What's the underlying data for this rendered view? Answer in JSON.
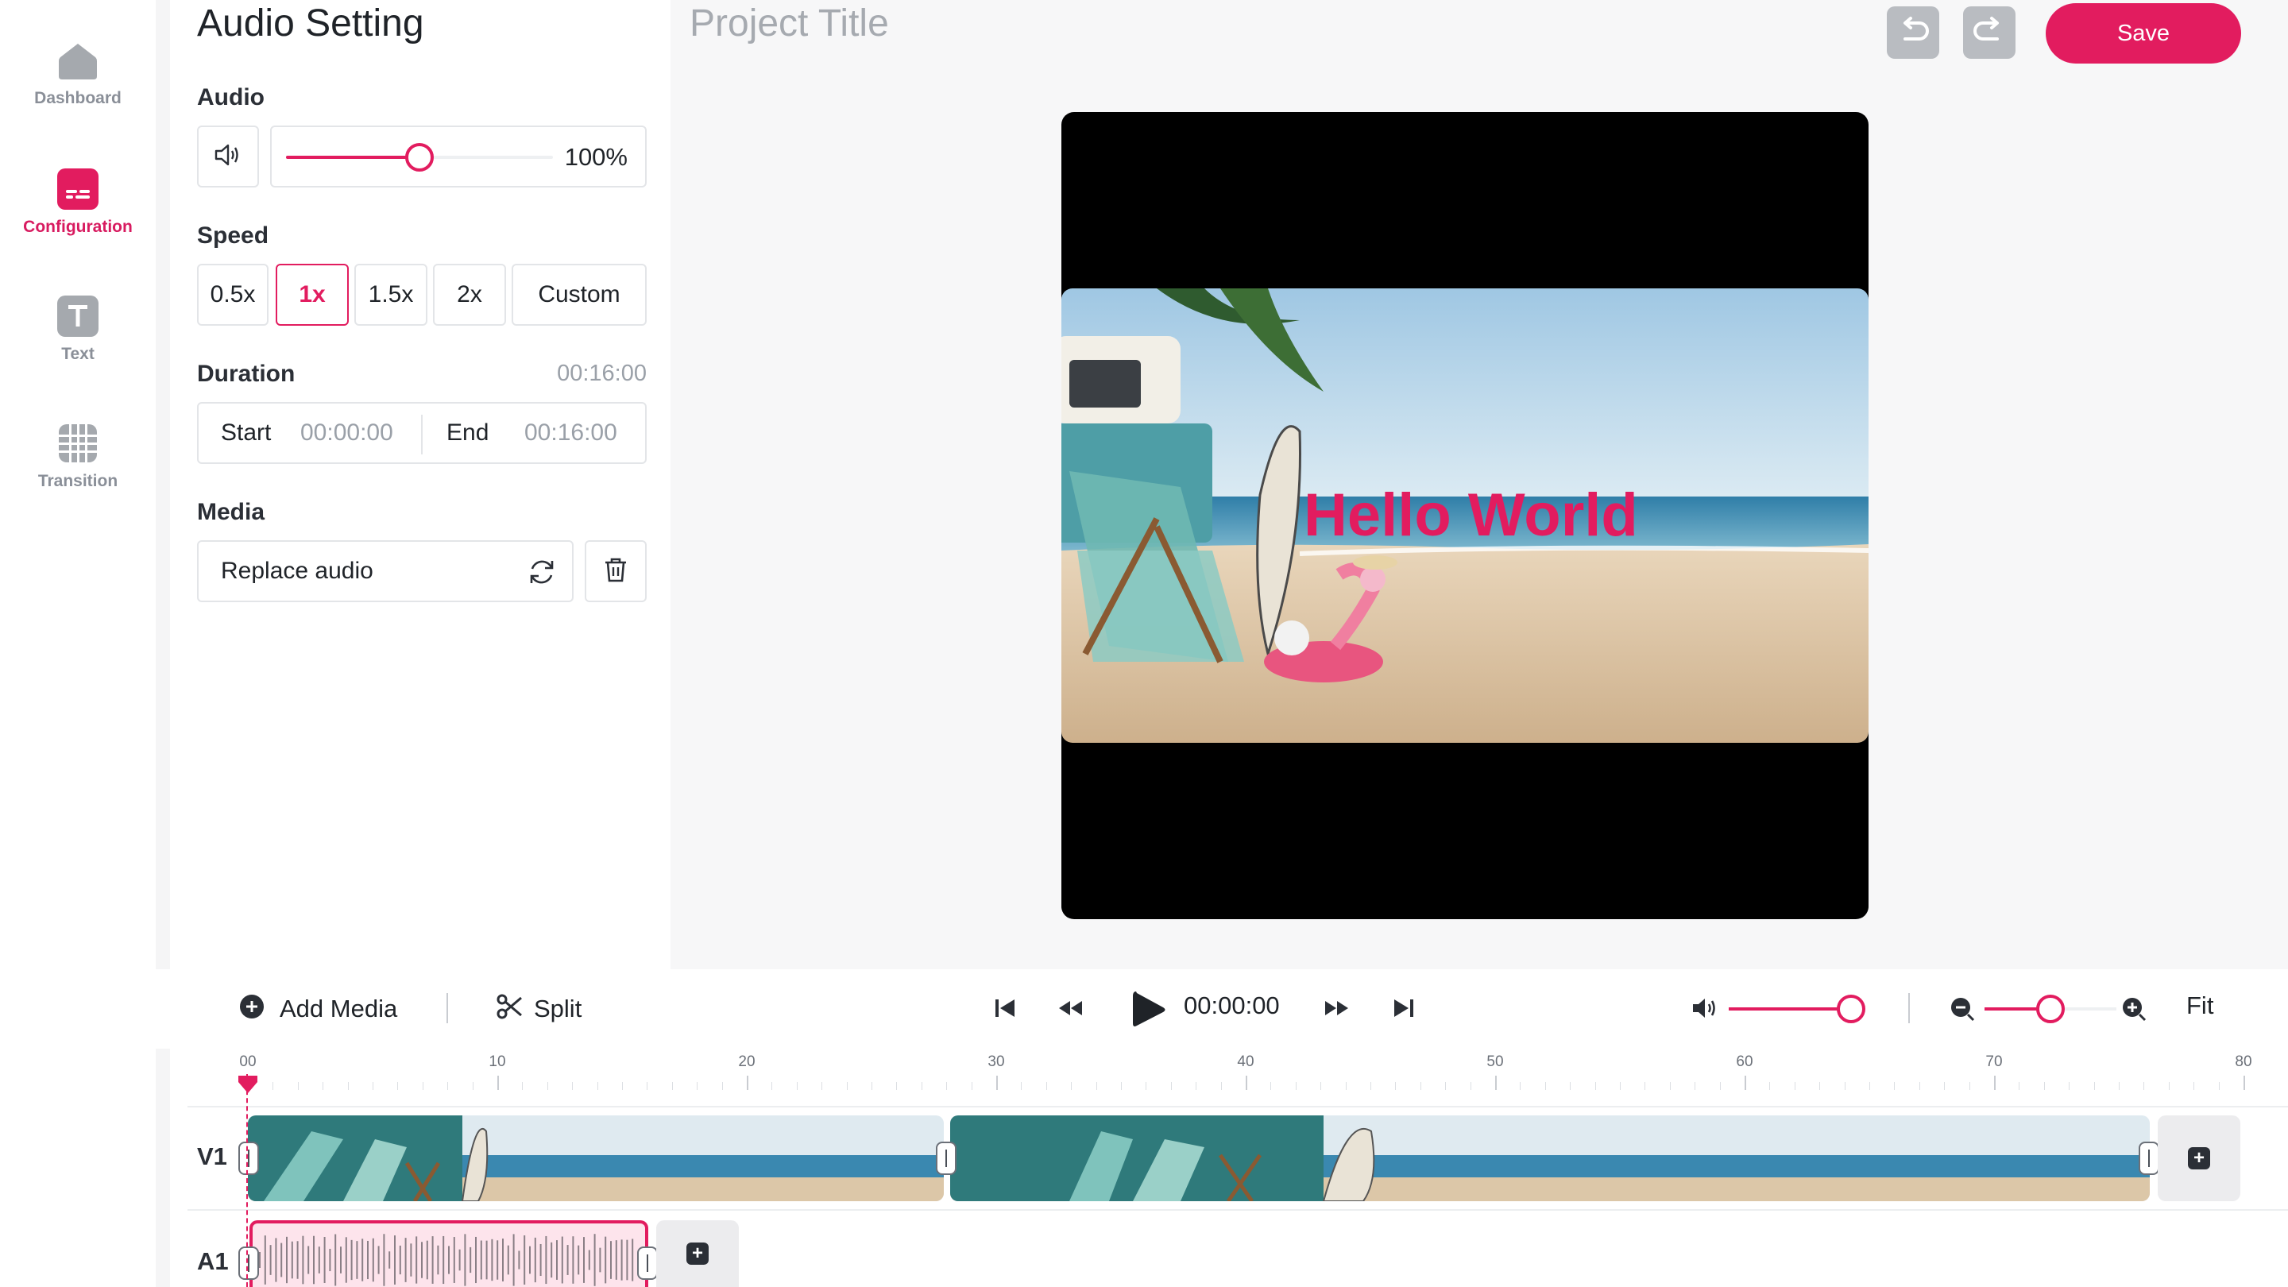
{
  "nav": {
    "items": [
      {
        "label": "Dashboard",
        "icon": "home-icon",
        "active": false
      },
      {
        "label": "Configuration",
        "icon": "subtitles-icon",
        "active": true
      },
      {
        "label": "Text",
        "icon": "text-icon",
        "active": false
      },
      {
        "label": "Transition",
        "icon": "grid-icon",
        "active": false
      }
    ]
  },
  "panel": {
    "title": "Audio Setting",
    "audio": {
      "label": "Audio",
      "volume_text": "100%",
      "volume_fraction": 0.5
    },
    "speed": {
      "label": "Speed",
      "options": [
        "0.5x",
        "1x",
        "1.5x",
        "2x",
        "Custom"
      ],
      "selected": "1x"
    },
    "duration": {
      "label": "Duration",
      "total": "00:16:00",
      "start_label": "Start",
      "start_value": "00:00:00",
      "end_label": "End",
      "end_value": "00:16:00"
    },
    "media": {
      "label": "Media",
      "replace_label": "Replace audio"
    }
  },
  "header": {
    "project_title": "Project Title",
    "save_label": "Save"
  },
  "preview": {
    "overlay_text": "Hello World"
  },
  "timeline": {
    "add_media_label": "Add Media",
    "split_label": "Split",
    "timecode": "00:00:00",
    "fit_label": "Fit",
    "volume_fraction": 0.93,
    "zoom_fraction": 0.5,
    "ruler_labels": [
      "00",
      "10",
      "20",
      "30",
      "40",
      "50",
      "60",
      "70",
      "80"
    ],
    "tracks": [
      {
        "label": "V1"
      },
      {
        "label": "A1"
      }
    ]
  },
  "colors": {
    "accent": "#e21c5f",
    "muted": "#9aa0a8",
    "panel_bg": "#f7f7f8"
  }
}
